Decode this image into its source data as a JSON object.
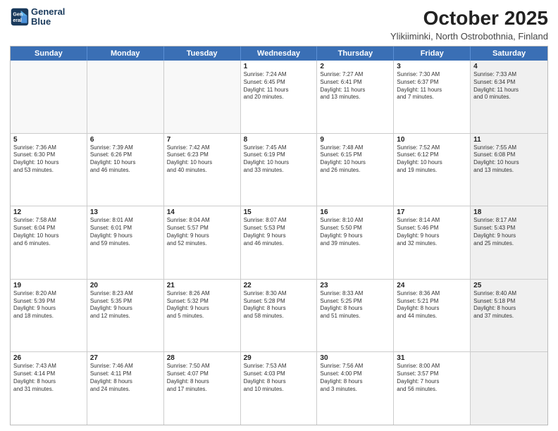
{
  "logo": {
    "line1": "General",
    "line2": "Blue"
  },
  "title": "October 2025",
  "subtitle": "Ylikiiminki, North Ostrobothnia, Finland",
  "weekdays": [
    "Sunday",
    "Monday",
    "Tuesday",
    "Wednesday",
    "Thursday",
    "Friday",
    "Saturday"
  ],
  "weeks": [
    [
      {
        "day": "",
        "text": "",
        "empty": true
      },
      {
        "day": "",
        "text": "",
        "empty": true
      },
      {
        "day": "",
        "text": "",
        "empty": true
      },
      {
        "day": "1",
        "text": "Sunrise: 7:24 AM\nSunset: 6:45 PM\nDaylight: 11 hours\nand 20 minutes."
      },
      {
        "day": "2",
        "text": "Sunrise: 7:27 AM\nSunset: 6:41 PM\nDaylight: 11 hours\nand 13 minutes."
      },
      {
        "day": "3",
        "text": "Sunrise: 7:30 AM\nSunset: 6:37 PM\nDaylight: 11 hours\nand 7 minutes."
      },
      {
        "day": "4",
        "text": "Sunrise: 7:33 AM\nSunset: 6:34 PM\nDaylight: 11 hours\nand 0 minutes.",
        "shaded": true
      }
    ],
    [
      {
        "day": "5",
        "text": "Sunrise: 7:36 AM\nSunset: 6:30 PM\nDaylight: 10 hours\nand 53 minutes."
      },
      {
        "day": "6",
        "text": "Sunrise: 7:39 AM\nSunset: 6:26 PM\nDaylight: 10 hours\nand 46 minutes."
      },
      {
        "day": "7",
        "text": "Sunrise: 7:42 AM\nSunset: 6:23 PM\nDaylight: 10 hours\nand 40 minutes."
      },
      {
        "day": "8",
        "text": "Sunrise: 7:45 AM\nSunset: 6:19 PM\nDaylight: 10 hours\nand 33 minutes."
      },
      {
        "day": "9",
        "text": "Sunrise: 7:48 AM\nSunset: 6:15 PM\nDaylight: 10 hours\nand 26 minutes."
      },
      {
        "day": "10",
        "text": "Sunrise: 7:52 AM\nSunset: 6:12 PM\nDaylight: 10 hours\nand 19 minutes."
      },
      {
        "day": "11",
        "text": "Sunrise: 7:55 AM\nSunset: 6:08 PM\nDaylight: 10 hours\nand 13 minutes.",
        "shaded": true
      }
    ],
    [
      {
        "day": "12",
        "text": "Sunrise: 7:58 AM\nSunset: 6:04 PM\nDaylight: 10 hours\nand 6 minutes."
      },
      {
        "day": "13",
        "text": "Sunrise: 8:01 AM\nSunset: 6:01 PM\nDaylight: 9 hours\nand 59 minutes."
      },
      {
        "day": "14",
        "text": "Sunrise: 8:04 AM\nSunset: 5:57 PM\nDaylight: 9 hours\nand 52 minutes."
      },
      {
        "day": "15",
        "text": "Sunrise: 8:07 AM\nSunset: 5:53 PM\nDaylight: 9 hours\nand 46 minutes."
      },
      {
        "day": "16",
        "text": "Sunrise: 8:10 AM\nSunset: 5:50 PM\nDaylight: 9 hours\nand 39 minutes."
      },
      {
        "day": "17",
        "text": "Sunrise: 8:14 AM\nSunset: 5:46 PM\nDaylight: 9 hours\nand 32 minutes."
      },
      {
        "day": "18",
        "text": "Sunrise: 8:17 AM\nSunset: 5:43 PM\nDaylight: 9 hours\nand 25 minutes.",
        "shaded": true
      }
    ],
    [
      {
        "day": "19",
        "text": "Sunrise: 8:20 AM\nSunset: 5:39 PM\nDaylight: 9 hours\nand 18 minutes."
      },
      {
        "day": "20",
        "text": "Sunrise: 8:23 AM\nSunset: 5:35 PM\nDaylight: 9 hours\nand 12 minutes."
      },
      {
        "day": "21",
        "text": "Sunrise: 8:26 AM\nSunset: 5:32 PM\nDaylight: 9 hours\nand 5 minutes."
      },
      {
        "day": "22",
        "text": "Sunrise: 8:30 AM\nSunset: 5:28 PM\nDaylight: 8 hours\nand 58 minutes."
      },
      {
        "day": "23",
        "text": "Sunrise: 8:33 AM\nSunset: 5:25 PM\nDaylight: 8 hours\nand 51 minutes."
      },
      {
        "day": "24",
        "text": "Sunrise: 8:36 AM\nSunset: 5:21 PM\nDaylight: 8 hours\nand 44 minutes."
      },
      {
        "day": "25",
        "text": "Sunrise: 8:40 AM\nSunset: 5:18 PM\nDaylight: 8 hours\nand 37 minutes.",
        "shaded": true
      }
    ],
    [
      {
        "day": "26",
        "text": "Sunrise: 7:43 AM\nSunset: 4:14 PM\nDaylight: 8 hours\nand 31 minutes."
      },
      {
        "day": "27",
        "text": "Sunrise: 7:46 AM\nSunset: 4:11 PM\nDaylight: 8 hours\nand 24 minutes."
      },
      {
        "day": "28",
        "text": "Sunrise: 7:50 AM\nSunset: 4:07 PM\nDaylight: 8 hours\nand 17 minutes."
      },
      {
        "day": "29",
        "text": "Sunrise: 7:53 AM\nSunset: 4:03 PM\nDaylight: 8 hours\nand 10 minutes."
      },
      {
        "day": "30",
        "text": "Sunrise: 7:56 AM\nSunset: 4:00 PM\nDaylight: 8 hours\nand 3 minutes."
      },
      {
        "day": "31",
        "text": "Sunrise: 8:00 AM\nSunset: 3:57 PM\nDaylight: 7 hours\nand 56 minutes."
      },
      {
        "day": "",
        "text": "",
        "empty": true,
        "shaded": true
      }
    ]
  ]
}
